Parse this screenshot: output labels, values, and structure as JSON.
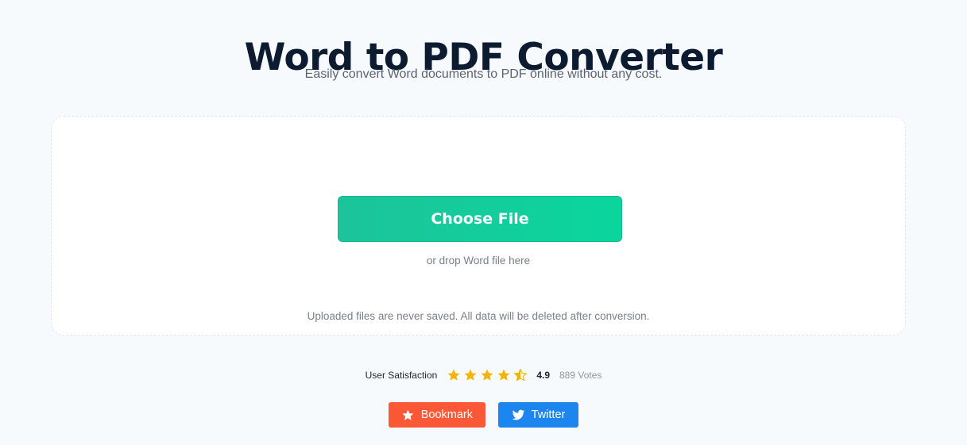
{
  "header": {
    "title": "Word to PDF Converter",
    "subtitle": "Easily convert Word documents to PDF online without any cost."
  },
  "upload": {
    "choose_label": "Choose File",
    "drop_hint": "or drop Word file here",
    "privacy_note": "Uploaded files are never saved. All data will be deleted after conversion."
  },
  "rating": {
    "label": "User Satisfaction",
    "score": "4.9",
    "votes": "889 Votes",
    "stars_filled": 4.5,
    "stars_total": 5,
    "star_color": "#f5b301"
  },
  "actions": {
    "bookmark_label": "Bookmark",
    "bookmark_icon": "star-icon",
    "bookmark_color": "#fb5838",
    "twitter_label": "Twitter",
    "twitter_icon": "twitter-bird-icon",
    "twitter_color": "#1c86ee"
  },
  "colors": {
    "accent": "#10c99a",
    "page_background": "#f6fafd"
  }
}
